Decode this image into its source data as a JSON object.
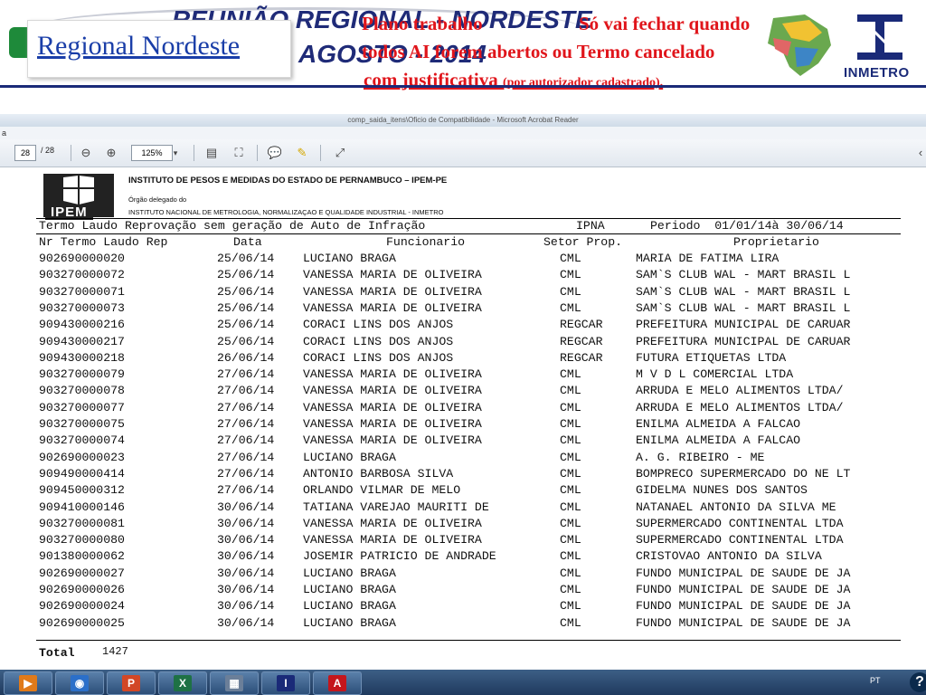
{
  "slide": {
    "bg_title_line1": "REUNIÃO REGIONAL - NORDESTE",
    "bg_title_line2": "AGOSTO - 2014",
    "regional_title": "Regional  Nordeste",
    "note_line1": "Plano trabalho",
    "note_line1b": " Só vai  fechar  quando",
    "note_line2": "todos AI forem abertos ou Termo cancelado",
    "note_line3": "com justificativa ",
    "note_line3_small": "(por autorizador cadastrado).",
    "inmetro_logo_text": "INMETRO",
    "colors": {
      "title_blue": "#1a3ea8",
      "note_red": "#e0151b",
      "inmetro_navy": "#1a2a78",
      "tab_green": "#1e8a3a"
    }
  },
  "viewer": {
    "window_title": "comp_saida_itens\\Oficio de Compatibilidade - Microsoft Acrobat Reader",
    "menu_fragment": "a",
    "page_current": "28",
    "page_total": "/ 28",
    "zoom": "125%",
    "icons": [
      "zoom-out-icon",
      "zoom-in-icon",
      "zoom-dropdown-icon",
      "save-icon",
      "fit-page-icon",
      "comment-icon",
      "sign-icon",
      "expand-icon"
    ]
  },
  "document": {
    "org_line1": "INSTITUTO DE PESOS E MEDIDAS DO ESTADO DE PERNAMBUCO – IPEM-PE",
    "org_line2": "Órgão delegado do",
    "org_line3": "INSTITUTO NACIONAL DE METROLOGIA, NORMALIZAÇAO E QUALIDADE INDUSTRIAL - INMETRO",
    "logo_label": "IPEM",
    "report_title": "Termo Laudo Reprovação sem geração de Auto de Infração",
    "report_unit": "IPNA",
    "report_period": "Periodo  01/01/14à 30/06/14",
    "columns": [
      "Nr Termo Laudo Rep",
      "Data",
      "Funcionario",
      "Setor Prop.",
      "Proprietario"
    ],
    "rows": [
      [
        "902690000020",
        "25/06/14",
        "LUCIANO BRAGA",
        "CML",
        "MARIA DE FATIMA LIRA"
      ],
      [
        "903270000072",
        "25/06/14",
        "VANESSA MARIA DE OLIVEIRA",
        "CML",
        "SAM`S CLUB WAL - MART BRASIL L"
      ],
      [
        "903270000071",
        "25/06/14",
        "VANESSA MARIA DE OLIVEIRA",
        "CML",
        "SAM`S CLUB WAL - MART BRASIL L"
      ],
      [
        "903270000073",
        "25/06/14",
        "VANESSA MARIA DE OLIVEIRA",
        "CML",
        "SAM`S CLUB WAL - MART BRASIL L"
      ],
      [
        "909430000216",
        "25/06/14",
        "CORACI LINS DOS ANJOS",
        "REGCAR",
        "PREFEITURA MUNICIPAL DE CARUAR"
      ],
      [
        "909430000217",
        "25/06/14",
        "CORACI LINS DOS ANJOS",
        "REGCAR",
        "PREFEITURA MUNICIPAL DE CARUAR"
      ],
      [
        "909430000218",
        "26/06/14",
        "CORACI LINS DOS ANJOS",
        "REGCAR",
        "FUTURA ETIQUETAS LTDA"
      ],
      [
        "903270000079",
        "27/06/14",
        "VANESSA MARIA DE OLIVEIRA",
        "CML",
        "M V D L COMERCIAL LTDA"
      ],
      [
        "903270000078",
        "27/06/14",
        "VANESSA MARIA DE OLIVEIRA",
        "CML",
        "ARRUDA E MELO ALIMENTOS LTDA/"
      ],
      [
        "903270000077",
        "27/06/14",
        "VANESSA MARIA DE OLIVEIRA",
        "CML",
        "ARRUDA E MELO ALIMENTOS LTDA/"
      ],
      [
        "903270000075",
        "27/06/14",
        "VANESSA MARIA DE OLIVEIRA",
        "CML",
        "ENILMA ALMEIDA A FALCAO"
      ],
      [
        "903270000074",
        "27/06/14",
        "VANESSA MARIA DE OLIVEIRA",
        "CML",
        "ENILMA ALMEIDA A FALCAO"
      ],
      [
        "902690000023",
        "27/06/14",
        "LUCIANO BRAGA",
        "CML",
        "A. G. RIBEIRO - ME"
      ],
      [
        "909490000414",
        "27/06/14",
        "ANTONIO BARBOSA SILVA",
        "CML",
        "BOMPRECO SUPERMERCADO DO NE LT"
      ],
      [
        "909450000312",
        "27/06/14",
        "ORLANDO VILMAR DE MELO",
        "CML",
        "GIDELMA NUNES DOS SANTOS"
      ],
      [
        "909410000146",
        "30/06/14",
        "TATIANA VAREJAO MAURITI DE",
        "CML",
        "NATANAEL ANTONIO DA SILVA ME"
      ],
      [
        "903270000081",
        "30/06/14",
        "VANESSA MARIA DE OLIVEIRA",
        "CML",
        "SUPERMERCADO CONTINENTAL LTDA"
      ],
      [
        "903270000080",
        "30/06/14",
        "VANESSA MARIA DE OLIVEIRA",
        "CML",
        "SUPERMERCADO CONTINENTAL LTDA"
      ],
      [
        "901380000062",
        "30/06/14",
        "JOSEMIR PATRICIO DE ANDRADE",
        "CML",
        "CRISTOVAO ANTONIO DA SILVA"
      ],
      [
        "902690000027",
        "30/06/14",
        "LUCIANO BRAGA",
        "CML",
        "FUNDO MUNICIPAL DE SAUDE DE JA"
      ],
      [
        "902690000026",
        "30/06/14",
        "LUCIANO BRAGA",
        "CML",
        "FUNDO MUNICIPAL DE SAUDE DE JA"
      ],
      [
        "902690000024",
        "30/06/14",
        "LUCIANO BRAGA",
        "CML",
        "FUNDO MUNICIPAL DE SAUDE DE JA"
      ],
      [
        "902690000025",
        "30/06/14",
        "LUCIANO BRAGA",
        "CML",
        "FUNDO MUNICIPAL DE SAUDE DE JA"
      ]
    ],
    "total_label": "Total",
    "total_value": "1427"
  },
  "taskbar": {
    "apps": [
      {
        "name": "media-player-icon",
        "glyph": "▶",
        "color": "#e07a1a"
      },
      {
        "name": "outlook-icon",
        "glyph": "◉",
        "color": "#2b6fc9"
      },
      {
        "name": "powerpoint-icon",
        "glyph": "P",
        "color": "#d24726"
      },
      {
        "name": "excel-icon",
        "glyph": "X",
        "color": "#1e7145"
      },
      {
        "name": "calculator-icon",
        "glyph": "▦",
        "color": "#6b7f99"
      },
      {
        "name": "inmetro-app-icon",
        "glyph": "I",
        "color": "#1a2a78"
      },
      {
        "name": "acrobat-icon",
        "glyph": "A",
        "color": "#c4161c"
      }
    ],
    "language": "PT",
    "help_glyph": "?"
  }
}
